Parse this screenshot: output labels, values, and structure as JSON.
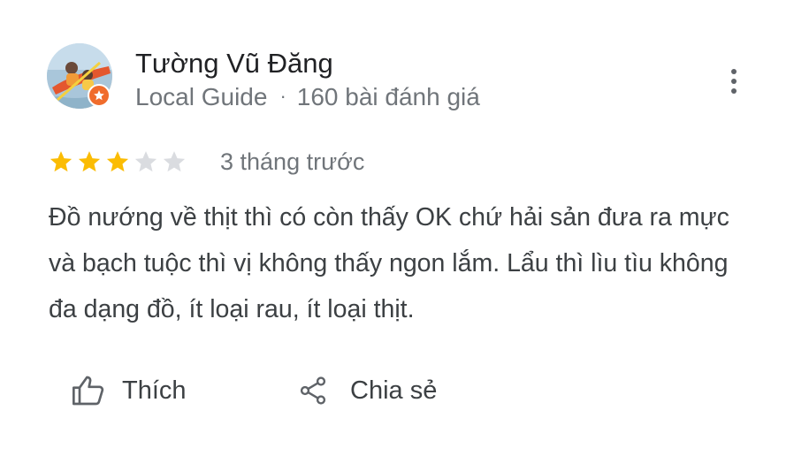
{
  "reviewer": {
    "name": "Tường Vũ Đăng",
    "badge": "Local Guide",
    "separator": "·",
    "review_count": "160 bài đánh giá"
  },
  "review": {
    "rating": 3,
    "max_rating": 5,
    "time": "3 tháng trước",
    "text": "Đồ nướng về thịt thì có còn thấy OK chứ hải sản đưa ra mực và bạch tuộc thì vị không thấy ngon lắm. Lẩu thì lìu tìu không đa dạng đồ, ít loại rau, ít loại thịt."
  },
  "actions": {
    "like_label": "Thích",
    "share_label": "Chia sẻ"
  },
  "icons": {
    "more": "more-vert-icon",
    "like": "thumb-up-icon",
    "share": "share-icon",
    "badge": "local-guide-star-icon"
  },
  "colors": {
    "star_filled": "#fbbc04",
    "star_empty": "#dadce0",
    "text_primary": "#202124",
    "text_secondary": "#70757a",
    "badge": "#f06c2c"
  }
}
